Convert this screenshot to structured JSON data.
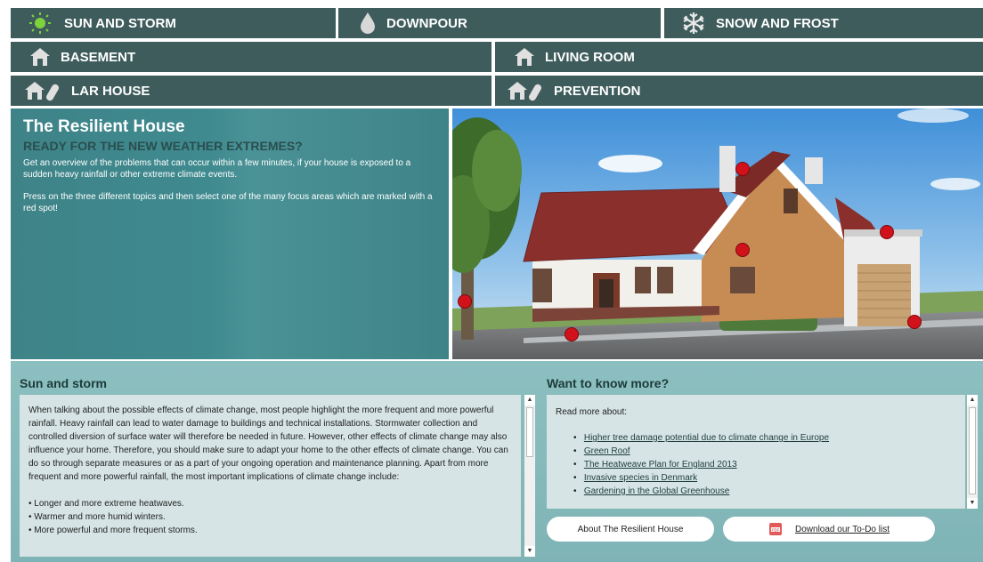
{
  "nav": {
    "sun_storm": "SUN AND STORM",
    "downpour": "DOWNPOUR",
    "snow_frost": "SNOW AND FROST",
    "basement": "BASEMENT",
    "living_room": "LIVING ROOM",
    "lar_house": "LAR HOUSE",
    "prevention": "PREVENTION"
  },
  "intro": {
    "title": "The Resilient House",
    "subtitle": "READY FOR THE NEW WEATHER EXTREMES?",
    "para1": "Get an overview of the problems that can occur within a few minutes, if your house is exposed to a sudden heavy rainfall or other extreme climate events.",
    "para2": "Press on the three different topics and then select one of the many focus areas which are marked with a red spot!"
  },
  "topic": {
    "title": "Sun and storm",
    "body": "When talking about the possible effects of climate change, most people highlight the more frequent and more powerful rainfall. Heavy rainfall can lead to water damage to buildings and technical installations. Stormwater collection and controlled diversion of surface water will therefore be needed in future. However, other effects of climate change may also influence your home. Therefore, you should make sure to adapt your home to the other effects of climate change. You can do so through separate measures or as a part of your ongoing operation and maintenance planning. Apart from more frequent and more powerful rainfall, the most important implications of climate change include:",
    "bullets": [
      "• Longer and more extreme heatwaves.",
      "• Warmer and more humid winters.",
      "• More powerful and more frequent storms."
    ]
  },
  "more": {
    "title": "Want to know more?",
    "intro": "Read more about:",
    "links": [
      "Higher tree damage potential due to climate change in Europe",
      "Green Roof",
      "The Heatweave Plan for England 2013",
      "Invasive species in Denmark",
      "Gardening in the Global Greenhouse"
    ]
  },
  "buttons": {
    "about": "About The Resilient House",
    "download": "Download our To-Do list"
  },
  "colors": {
    "nav_bg": "#3f5c5c",
    "hotspot": "#d2121a",
    "panel": "#3f8a8f"
  }
}
